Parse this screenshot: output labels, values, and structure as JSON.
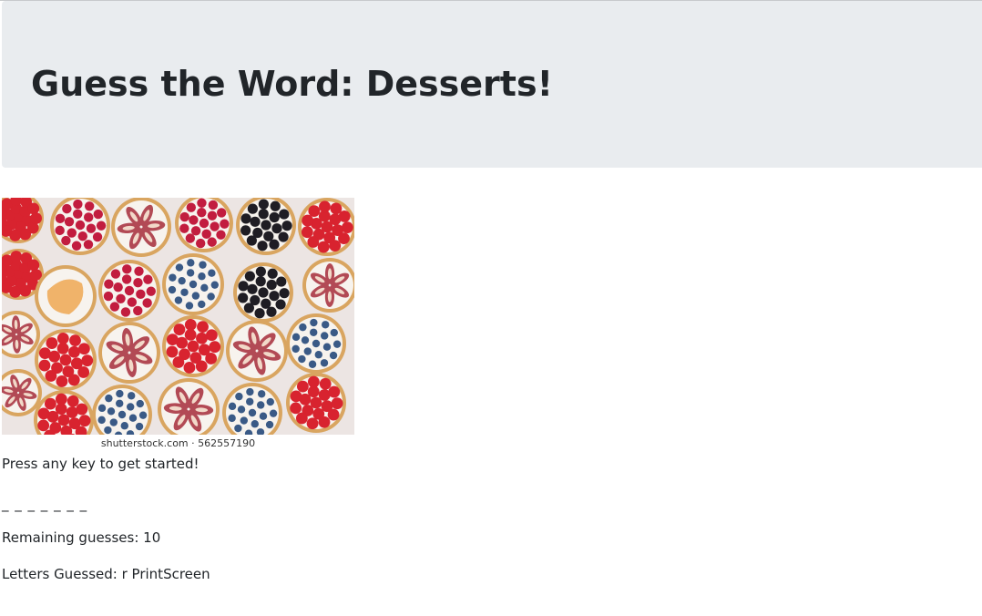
{
  "header": {
    "title": "Guess the Word: Desserts!"
  },
  "image": {
    "subject": "assorted fruit tarts (strawberry, raspberry, fig, blueberry, blackberry, peach)",
    "credit": "shutterstock.com · 562557190"
  },
  "game": {
    "prompt": "Press any key to get started!",
    "word_blanks": "_ _ _ _ _ _ _",
    "remaining_label": "Remaining guesses: 10",
    "remaining_guesses": 10,
    "letters_guessed_label": "Letters Guessed: r PrintScreen"
  },
  "colors": {
    "jumbotron_bg": "#e9ecef",
    "text": "#212529",
    "strawberry": "#d8232f",
    "raspberry": "#c21d3f",
    "fig": "#b24a55",
    "blueberry": "#3a5a86",
    "blackberry": "#1f1d24",
    "peach": "#f0b36a",
    "crust": "#d9a560",
    "cream": "#f7f3ee"
  }
}
